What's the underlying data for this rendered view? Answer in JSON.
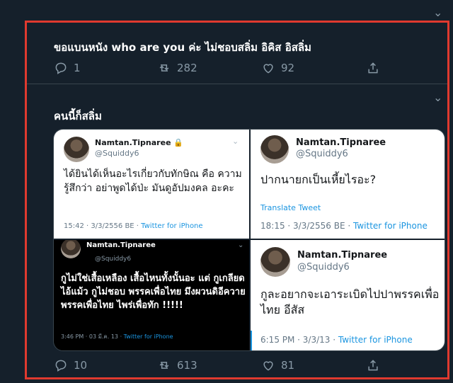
{
  "tweet": {
    "text": "ขอแบนหนัง who are you ค่ะ ไม่ชอบสลิ่ม อิคิส อิสลิ่ม",
    "replies": "1",
    "retweets": "282",
    "likes": "92"
  },
  "reply_tweet": {
    "text": "คนนี้ก็สลิ่ม",
    "replies": "10",
    "retweets": "613",
    "likes": "81"
  },
  "screenshots": [
    {
      "name": "Namtan.Tipnaree",
      "handle": "@Squiddy6",
      "text": "ได้ยินได้เห็นอะไรเกี่ยวกับทักษิณ คือ ความรู้สึกว่า อย่าพูดได้ป่ะ มันดูอัปมงคล อะคะ",
      "time": "15:42 · 3/3/2556 BE · ",
      "source": "Twitter for iPhone"
    },
    {
      "name": "Namtan.Tipnaree",
      "handle": "@Squiddy6",
      "text": "ปากนายกเป็นเหี้ยไรอะ?",
      "translate": "Translate Tweet",
      "time": "18:15 · 3/3/2556 BE · ",
      "source": "Twitter for iPhone"
    },
    {
      "name": "Namtan.Tipnaree",
      "handle": "@Squiddy6",
      "text": "กูไม่ใช่เสื้อเหลือง เสื้อไหนทั้งนั้นอะ แต่ กูเกลียดไอ้แม้ว กูไม่ชอบ พรรคเพื่อไทย มึงผวนดิอีควาย พรรคเพื่อไทย ไพร่เพื่อทัก !!!!!",
      "time": "3:46 PM · 03 มี.ค. 13 · ",
      "source": "Twitter for iPhone"
    },
    {
      "name": "Namtan.Tipnaree",
      "handle": "@Squiddy6",
      "text": "กูละอยากจะเอาระเบิดไปปาพรรคเพื่อ ไทย อีสัส",
      "time": "6:15 PM · 3/3/13 · ",
      "source": "Twitter for iPhone"
    }
  ]
}
